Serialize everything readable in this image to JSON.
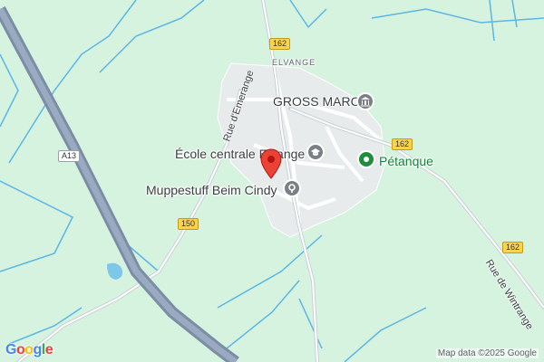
{
  "map": {
    "place_label": "ELVANGE",
    "pois": [
      {
        "label": "GROSS MARC",
        "icon": "museum-icon"
      },
      {
        "label": "École centrale Elvange",
        "icon": "school-icon"
      },
      {
        "label": "Pétanque",
        "icon": "sport-pin-icon"
      },
      {
        "label": "Muppestuff Beim Cindy",
        "icon": "place-pin-icon"
      }
    ],
    "roads": {
      "rue_emerange": "Rue d'Emerange",
      "rue_wintrange": "Rue de Wintrange"
    },
    "shields": {
      "r162_top": "162",
      "r162_right": "162",
      "r162_bottom": "162",
      "r150": "150",
      "a13": "A13"
    },
    "attribution": "Map data ©2025 Google",
    "logo": "Google",
    "colors": {
      "land": "#d6f3df",
      "water": "#5bb6e6",
      "motorway": "#8a9bb4",
      "marker": "#ea4335"
    }
  }
}
